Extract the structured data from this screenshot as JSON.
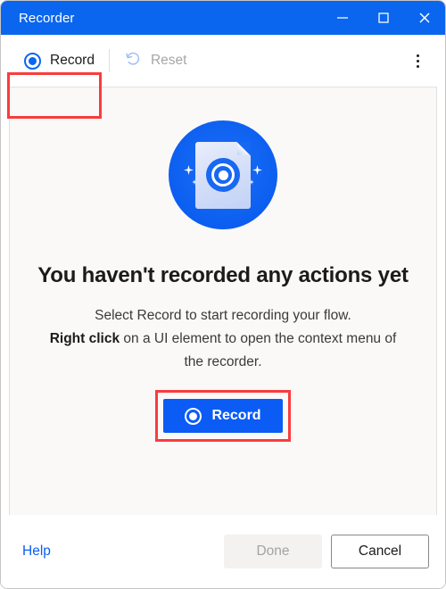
{
  "window": {
    "title": "Recorder",
    "controls": {
      "minimize": "minimize",
      "maximize": "maximize",
      "close": "close"
    }
  },
  "toolbar": {
    "record_label": "Record",
    "reset_label": "Reset",
    "reset_disabled": true,
    "overflow_label": "More options"
  },
  "content": {
    "headline": "You haven't recorded any actions yet",
    "desc_line1": "Select Record to start recording your flow.",
    "desc_bold": "Right click",
    "desc_line2": " on a UI element to open the context menu of the recorder.",
    "record_button_label": "Record"
  },
  "footer": {
    "help_label": "Help",
    "done_label": "Done",
    "cancel_label": "Cancel"
  },
  "colors": {
    "titlebar": "#0a66ef",
    "accent": "#0a5cf5",
    "annotation": "#fa3c3c",
    "content_bg": "#faf9f8",
    "link": "#0a60ef",
    "disabled_text": "#a6a6a6"
  }
}
